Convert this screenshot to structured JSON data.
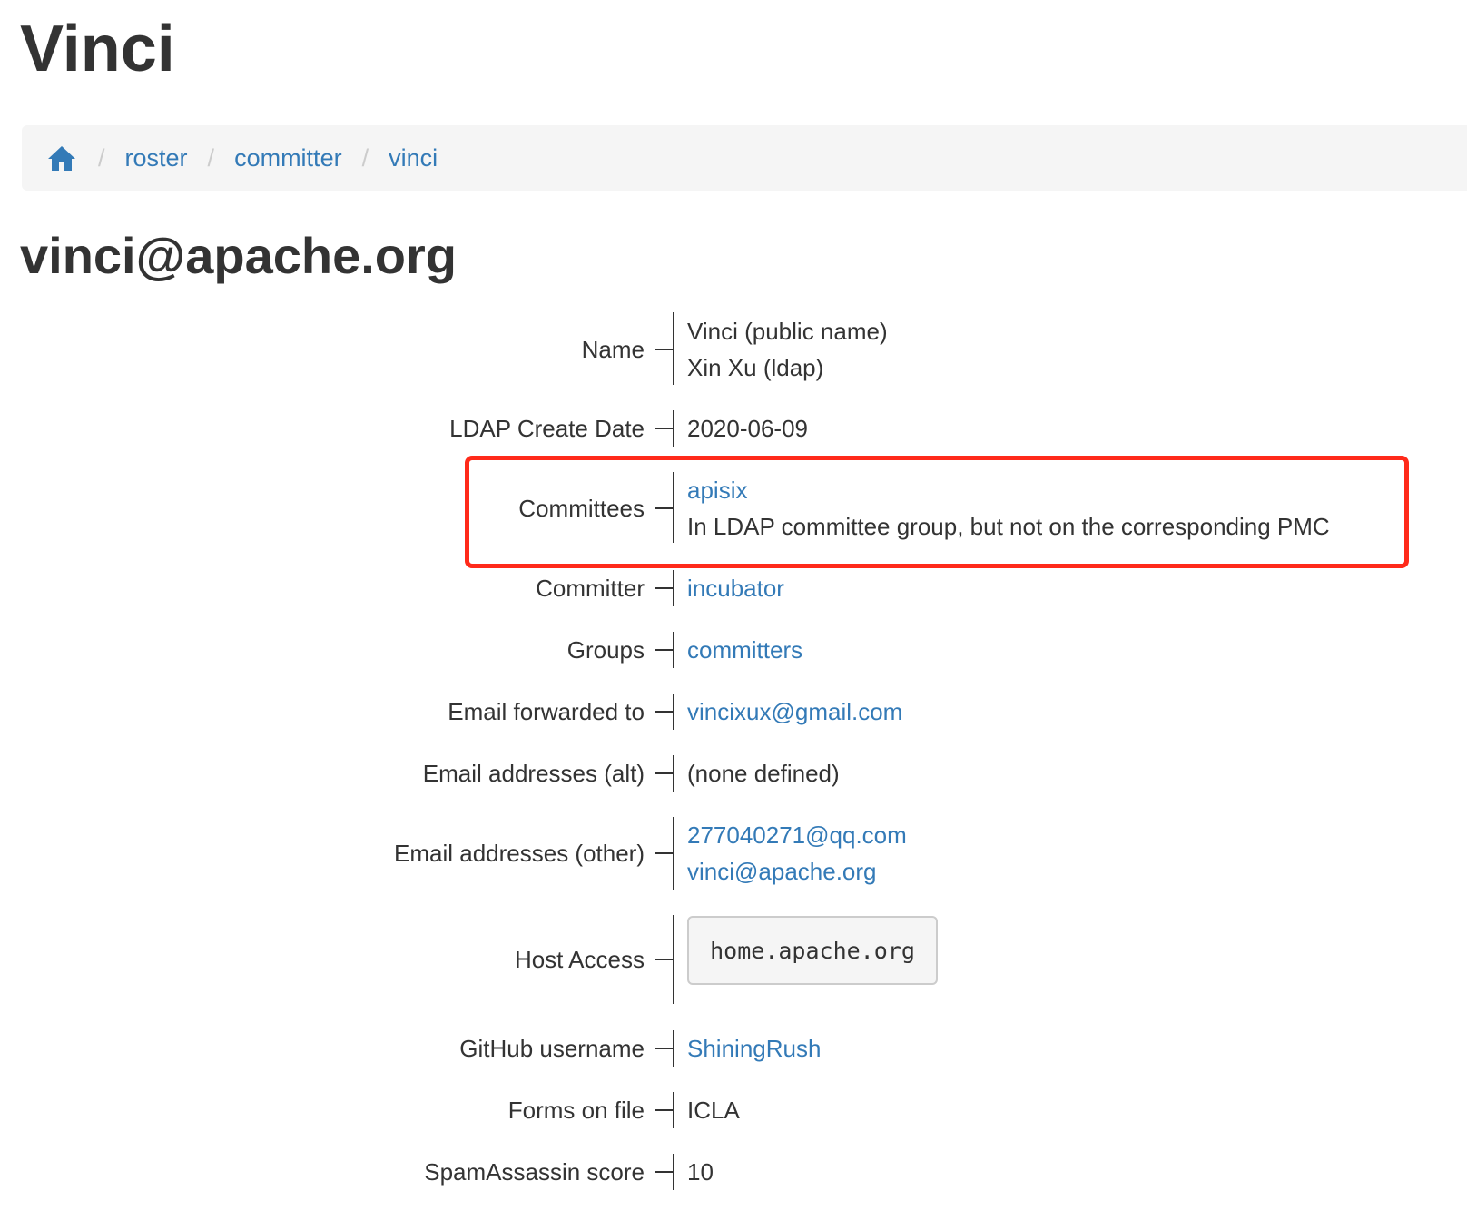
{
  "app_title": "Vinci",
  "breadcrumb": {
    "home_icon": "home-icon",
    "separator": "/",
    "items": [
      "roster",
      "committer",
      "vinci"
    ]
  },
  "page_heading": "vinci@apache.org",
  "fields": {
    "name": {
      "label": "Name",
      "values": [
        "Vinci (public name)",
        "Xin Xu (ldap)"
      ]
    },
    "ldap_create_date": {
      "label": "LDAP Create Date",
      "value": "2020-06-09"
    },
    "committees": {
      "label": "Committees",
      "link": "apisix",
      "note": "In LDAP committee group, but not on the corresponding PMC"
    },
    "committer": {
      "label": "Committer",
      "link": "incubator"
    },
    "groups": {
      "label": "Groups",
      "link": "committers"
    },
    "email_forwarded": {
      "label": "Email forwarded to",
      "link": "vincixux@gmail.com"
    },
    "email_alt": {
      "label": "Email addresses (alt)",
      "value": "(none defined)"
    },
    "email_other": {
      "label": "Email addresses (other)",
      "links": [
        "277040271@qq.com",
        "vinci@apache.org"
      ]
    },
    "host_access": {
      "label": "Host Access",
      "value": "home.apache.org"
    },
    "github": {
      "label": "GitHub username",
      "link": "ShiningRush"
    },
    "forms": {
      "label": "Forms on file",
      "value": "ICLA"
    },
    "spam": {
      "label": "SpamAssassin score",
      "value": "10"
    }
  },
  "colors": {
    "link": "#337ab7",
    "highlight": "#ff2a1a",
    "text": "#333333"
  }
}
